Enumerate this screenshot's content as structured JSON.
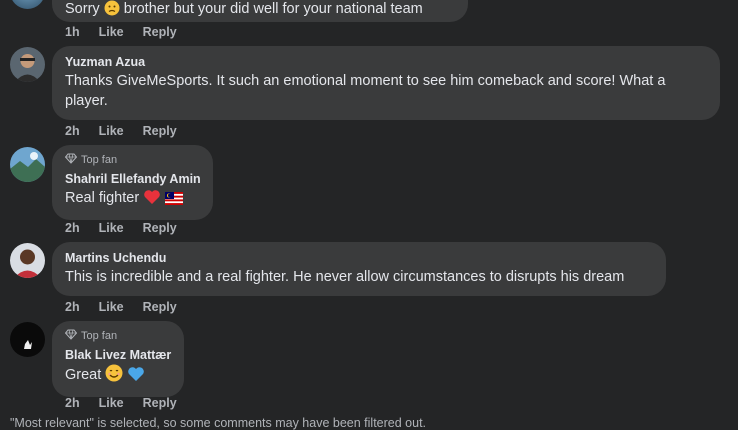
{
  "comments": [
    {
      "name": "",
      "text": "Sorry",
      "text_tail": "brother but your did well for your national team",
      "emoji": "worried-face",
      "time": "1h",
      "like": "Like",
      "reply": "Reply"
    },
    {
      "name": "Yuzman Azua",
      "text": "Thanks GiveMeSports. It such an emotional moment to see him comeback and score! What a player.",
      "time": "2h",
      "like": "Like",
      "reply": "Reply"
    },
    {
      "badge": "Top fan",
      "name": "Shahril Ellefandy Amin",
      "text": "Real fighter",
      "emojis": [
        "red-heart",
        "malaysia-flag"
      ],
      "time": "2h",
      "like": "Like",
      "reply": "Reply"
    },
    {
      "name": "Martins Uchendu",
      "text": "This is incredible and a real fighter. He never allow circumstances to disrupts his dream",
      "time": "2h",
      "like": "Like",
      "reply": "Reply"
    },
    {
      "badge": "Top fan",
      "name": "Blak Livez Mattær",
      "text": "Great",
      "emojis": [
        "smiling-face",
        "blue-heart"
      ],
      "time": "2h",
      "like": "Like",
      "reply": "Reply"
    }
  ],
  "footer": {
    "text": "\"Most relevant\" is selected, so some comments may have been filtered out."
  },
  "colors": {
    "background": "#242526",
    "bubble": "#3a3b3c",
    "text": "#e4e6eb",
    "secondary": "#b0b3b8"
  }
}
